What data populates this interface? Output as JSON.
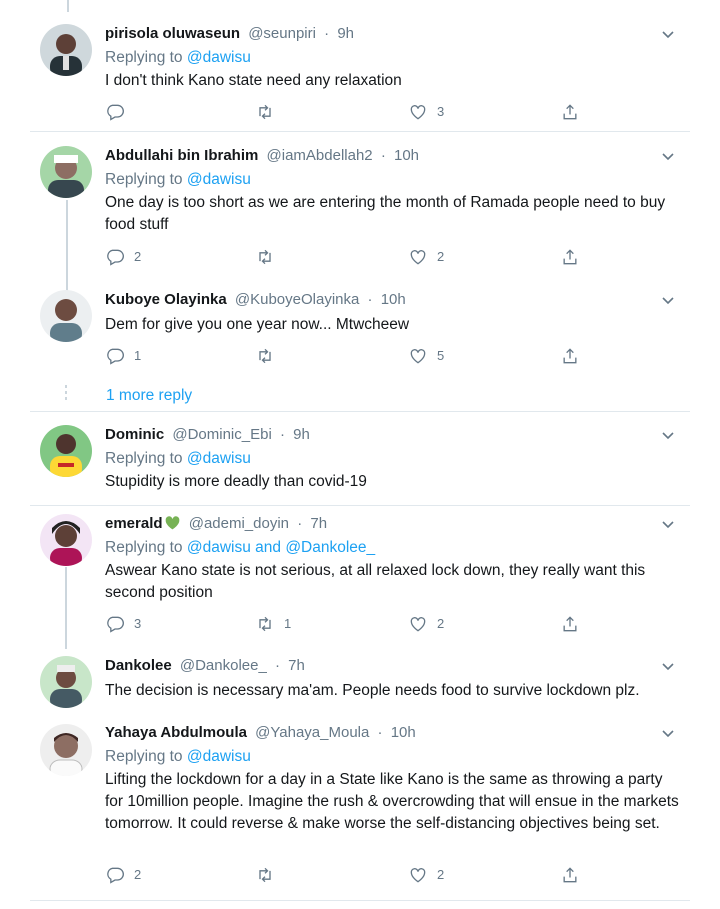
{
  "colors": {
    "link": "#1da1f2",
    "muted": "#657786",
    "text": "#14171a",
    "divider": "#e1e8ed",
    "heart_green": "#77b255"
  },
  "icons": {
    "reply": "reply-icon",
    "retweet": "retweet-icon",
    "like": "heart-icon",
    "share": "share-icon",
    "menu": "chevron-down-icon"
  },
  "more_reply_label": "1 more reply",
  "tweets": [
    {
      "name": "pirisola oluwaseun",
      "handle": "@seunpiri",
      "sep": "·",
      "time": "9h",
      "replying_prefix": "Replying to",
      "replying_to": "@dawisu",
      "text": "I don't think Kano state need any relaxation",
      "replies": "",
      "retweets": "",
      "likes": "3"
    },
    {
      "name": "Abdullahi bin Ibrahim",
      "handle": "@iamAbdellah2",
      "sep": "·",
      "time": "10h",
      "replying_prefix": "Replying to",
      "replying_to": "@dawisu",
      "text": "One day is too short as we are entering the month of Ramada people need to buy food stuff",
      "replies": "2",
      "retweets": "",
      "likes": "2"
    },
    {
      "name": "Kuboye Olayinka",
      "handle": "@KuboyeOlayinka",
      "sep": "·",
      "time": "10h",
      "text": "Dem for give you one year now... Mtwcheew",
      "replies": "1",
      "retweets": "",
      "likes": "5"
    },
    {
      "name": "Dominic",
      "handle": "@Dominic_Ebi",
      "sep": "·",
      "time": "9h",
      "replying_prefix": "Replying to",
      "replying_to": "@dawisu",
      "text": "Stupidity is more deadly than covid-19"
    },
    {
      "name": "emerald",
      "name_emoji": "green-heart-icon",
      "handle": "@ademi_doyin",
      "sep": "·",
      "time": "7h",
      "replying_prefix": "Replying to",
      "replying_to": "@dawisu and @Dankolee_",
      "text": "Aswear Kano state is not serious, at all relaxed lock down, they really want this second position",
      "replies": "3",
      "retweets": "1",
      "likes": "2"
    },
    {
      "name": "Dankolee",
      "handle": "@Dankolee_",
      "sep": "·",
      "time": "7h",
      "text": "The decision is necessary ma'am. People needs food to survive lockdown plz."
    },
    {
      "name": "Yahaya Abdulmoula",
      "handle": "@Yahaya_Moula",
      "sep": "·",
      "time": "10h",
      "replying_prefix": "Replying to",
      "replying_to": "@dawisu",
      "text": "Lifting the lockdown for a day in a State like Kano is the same as throwing a party for 10million people. Imagine the rush & overcrowding that will ensue in the markets tomorrow. It could reverse & make worse the self-distancing objectives being set.",
      "replies": "2",
      "retweets": "",
      "likes": "2"
    }
  ]
}
